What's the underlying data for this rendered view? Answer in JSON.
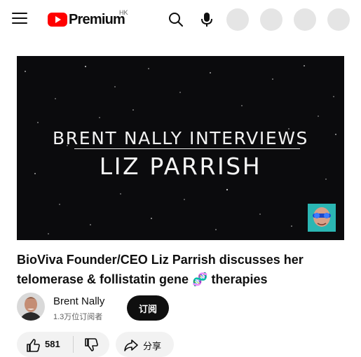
{
  "header": {
    "logo_text": "Premium",
    "region": "HK",
    "icons": [
      "menu-icon",
      "search-icon",
      "mic-icon"
    ]
  },
  "video": {
    "thumbnail_line1": "BRENT NALLY INTERVIEWS",
    "thumbnail_line2": "LIZ PARRISH",
    "title": "BioViva Founder/CEO Liz Parrish discusses her telomerase & follistatin gene 🧬 therapies"
  },
  "channel": {
    "name": "Brent Nally",
    "subscribers": "1.3万位订阅者",
    "subscribe_label": "订阅"
  },
  "actions": {
    "like_count": "581",
    "share_label": "分享"
  },
  "colors": {
    "brand_red": "#ff0000",
    "subscribe_bg": "#0f0f0f",
    "pill_bg": "#f2f2f2",
    "placeholder_circle": "#e5e5e5"
  }
}
